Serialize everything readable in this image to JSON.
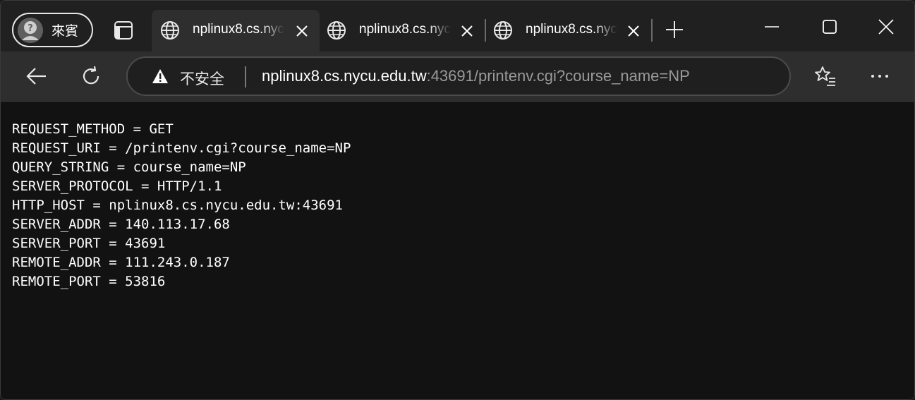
{
  "profile": {
    "label": "來賓",
    "icon": "question-avatar-icon"
  },
  "tabs": [
    {
      "title": "nplinux8.cs.nycu.edu.tw",
      "active": true,
      "icon": "globe-icon"
    },
    {
      "title": "nplinux8.cs.nycu.edu.tw",
      "active": false,
      "icon": "globe-icon"
    },
    {
      "title": "nplinux8.cs.nycu.edu.tw",
      "active": false,
      "icon": "globe-icon"
    }
  ],
  "address_bar": {
    "security_label": "不安全",
    "url_host": "nplinux8.cs.nycu.edu.tw",
    "url_rest": ":43691/printenv.cgi?course_name=NP"
  },
  "content": {
    "lines": [
      "REQUEST_METHOD = GET",
      "REQUEST_URI = /printenv.cgi?course_name=NP",
      "QUERY_STRING = course_name=NP",
      "SERVER_PROTOCOL = HTTP/1.1",
      "HTTP_HOST = nplinux8.cs.nycu.edu.tw:43691",
      "SERVER_ADDR = 140.113.17.68",
      "SERVER_PORT = 43691",
      "REMOTE_ADDR = 111.243.0.187",
      "REMOTE_PORT = 53816"
    ]
  },
  "colors": {
    "titlebar_bg": "#202020",
    "toolbar_bg": "#2e2e2e",
    "page_bg": "#121212",
    "text": "#ffffff",
    "url_dim": "#9a9a9a"
  }
}
